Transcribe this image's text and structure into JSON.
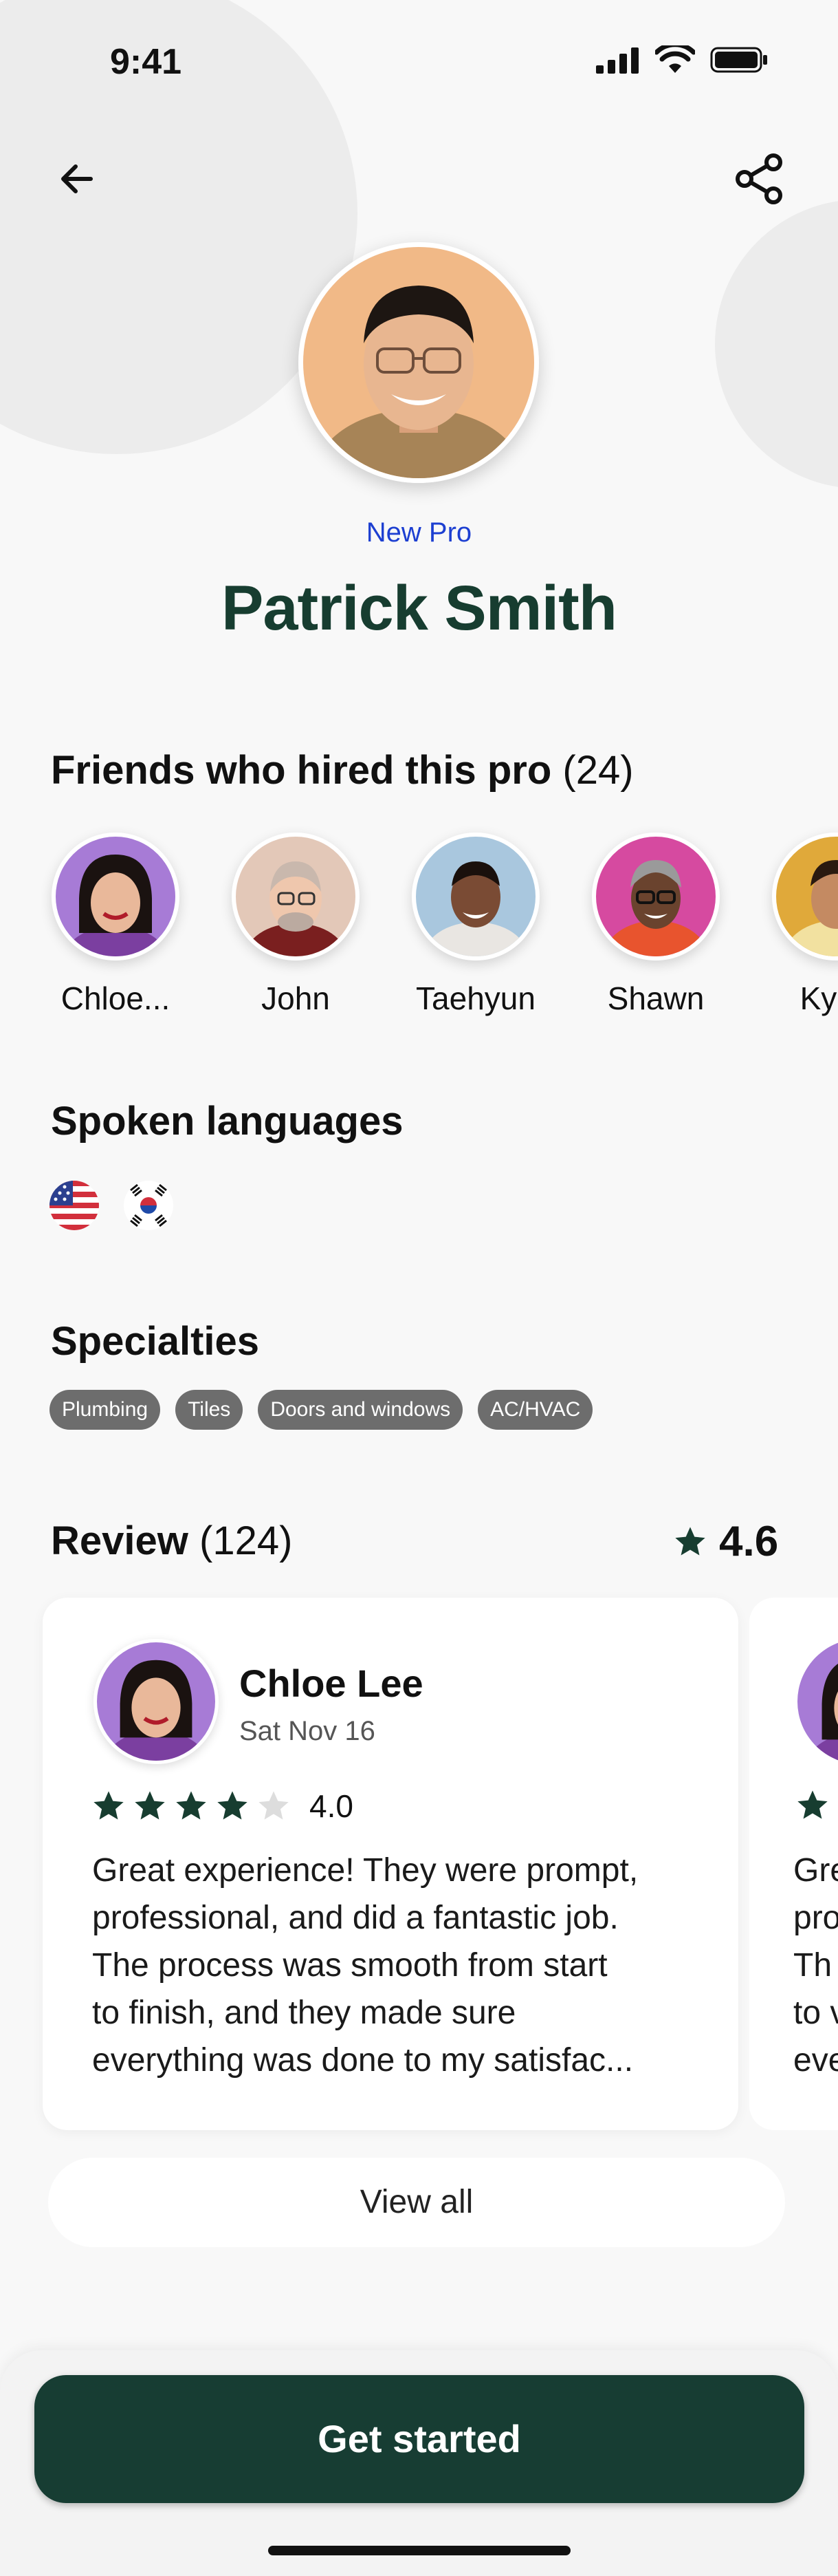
{
  "status_bar": {
    "time": "9:41"
  },
  "profile": {
    "tag": "New Pro",
    "name": "Patrick Smith"
  },
  "friends": {
    "title": "Friends who hired this pro",
    "count": "(24)",
    "items": [
      {
        "name": "Chloe...",
        "color": "#a77bd6",
        "skin": "#e9b89a"
      },
      {
        "name": "John",
        "color": "#d9b6a4",
        "skin": "#efc7ad"
      },
      {
        "name": "Taehyun",
        "color": "#a9c7de",
        "skin": "#7a4b34"
      },
      {
        "name": "Shawn",
        "color": "#d64aa0",
        "skin": "#6a432e"
      },
      {
        "name": "Kyun",
        "color": "#e0a93a",
        "skin": "#c48a62"
      }
    ]
  },
  "languages": {
    "title": "Spoken languages",
    "flags": [
      "us-flag-icon",
      "korea-flag-icon"
    ]
  },
  "specialties": {
    "title": "Specialties",
    "chips": [
      "Plumbing",
      "Tiles",
      "Doors and windows",
      "AC/HVAC"
    ]
  },
  "reviews": {
    "title": "Review",
    "count": "(124)",
    "rating": "4.6",
    "card": {
      "name": "Chloe Lee",
      "date": "Sat Nov 16",
      "stars": 4,
      "score": "4.0",
      "lines": [
        "Great experience! They were prompt,",
        "professional, and did a fantastic job.",
        "The process was smooth from start",
        "to finish, and they made sure",
        "everything was done to my satisfac..."
      ]
    },
    "peek_lines": [
      "Gre",
      "pro",
      "Th",
      "to v",
      "eve"
    ],
    "view_all": "View all"
  },
  "cta": {
    "label": "Get started"
  },
  "colors": {
    "brand": "#173d33",
    "accent_blue": "#1d3fd1",
    "star": "#173d30"
  }
}
